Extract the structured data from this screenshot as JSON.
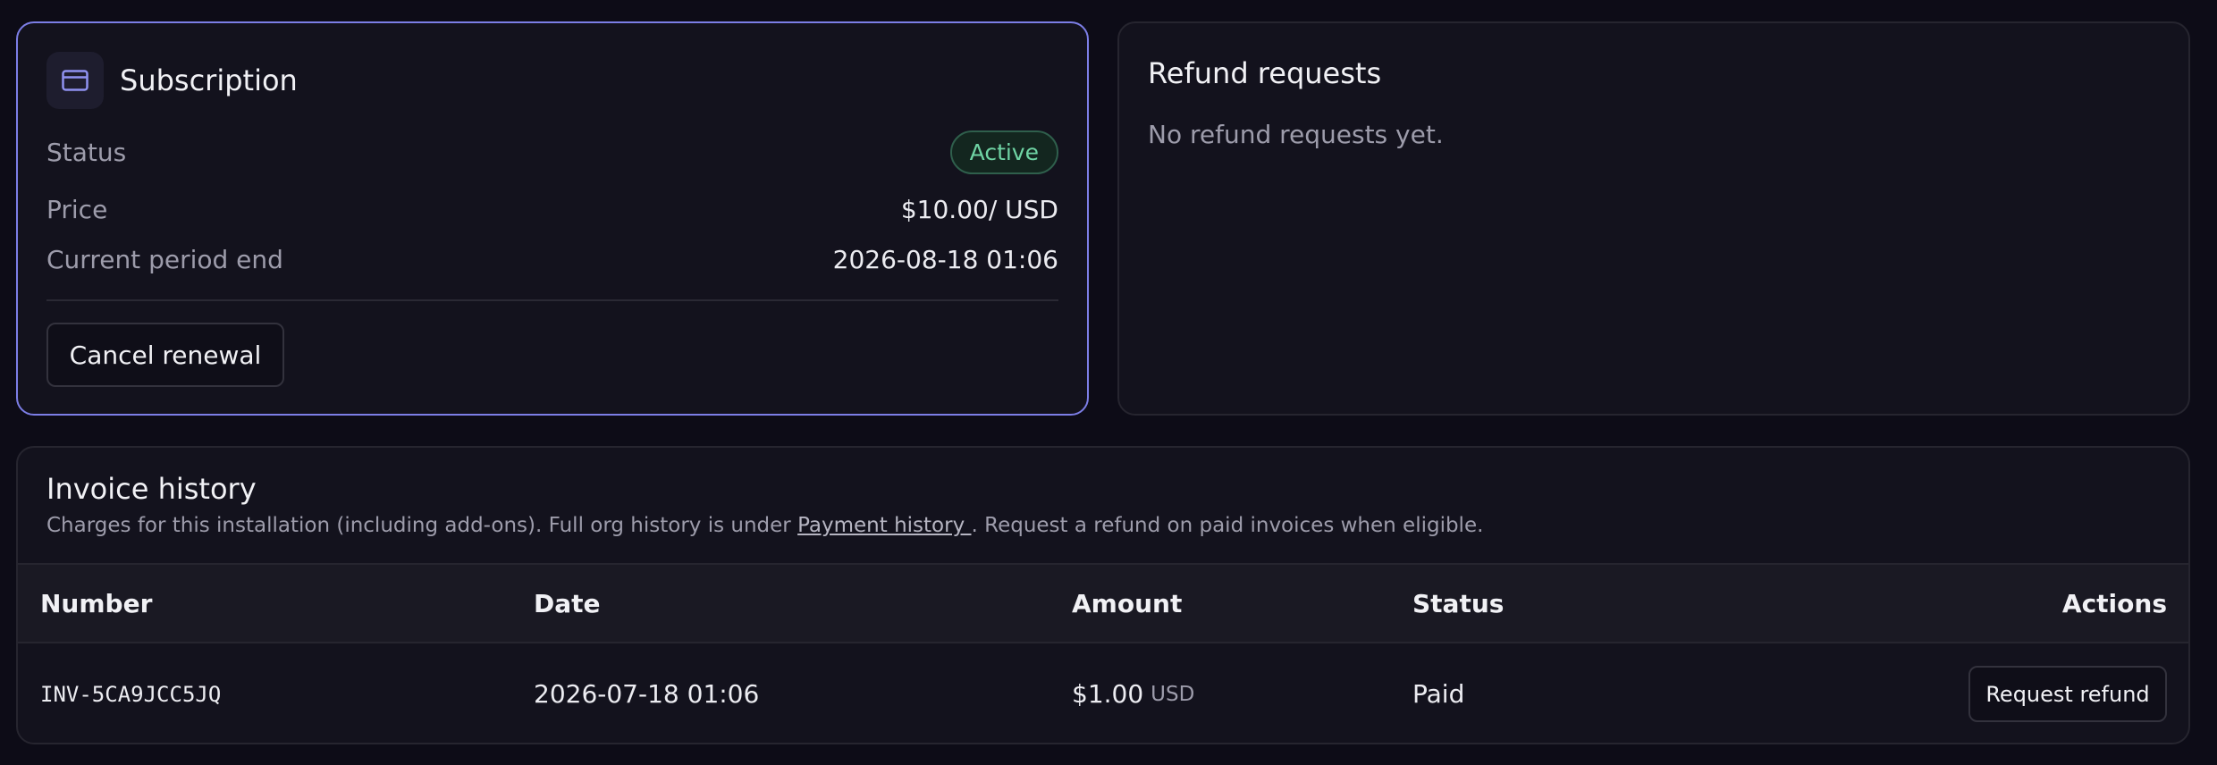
{
  "subscription": {
    "title": "Subscription",
    "icon": "credit-card-icon",
    "status_label": "Status",
    "status_value": "Active",
    "price_label": "Price",
    "price_value": "$10.00/ USD",
    "period_label": "Current period end",
    "period_value": "2026-08-18 01:06",
    "cancel_label": "Cancel renewal",
    "accent_color": "#7c7ee6"
  },
  "refunds": {
    "title": "Refund requests",
    "empty_text": "No refund requests yet."
  },
  "invoices": {
    "title": "Invoice history",
    "desc_before": "Charges for this installation (including add-ons). Full org history is under ",
    "desc_link": "Payment history ",
    "desc_after": ". Request a refund on paid invoices when eligible.",
    "columns": {
      "number": "Number",
      "date": "Date",
      "amount": "Amount",
      "status": "Status",
      "actions": "Actions"
    },
    "rows": [
      {
        "number": "INV-5CA9JCC5JQ",
        "date": "2026-07-18 01:06",
        "amount": "$1.00",
        "currency": "USD",
        "status": "Paid",
        "action_label": "Request refund"
      }
    ]
  }
}
